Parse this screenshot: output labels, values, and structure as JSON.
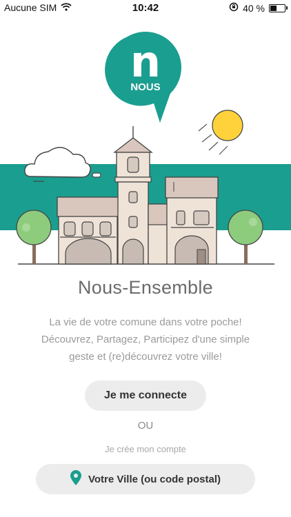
{
  "status_bar": {
    "carrier": "Aucune SIM",
    "time": "10:42",
    "battery_percent": "40 %",
    "battery_level": 0.4
  },
  "logo": {
    "letter": "n",
    "word": "NOUS"
  },
  "app": {
    "name": "Nous-Ensemble",
    "tagline_lines": [
      "La vie de votre comune dans votre poche!",
      "Découvrez, Partagez, Participez d'une simple",
      "geste et (re)découvrez votre ville!"
    ]
  },
  "actions": {
    "connect_label": "Je me connecte",
    "or_label": "OU",
    "create_account_label": "Je crée mon compte",
    "city_button_label": "Votre Ville (ou code postal)"
  },
  "colors": {
    "brand_teal": "#1a9e8f",
    "sun_yellow": "#ffd23c",
    "tree_green": "#8dcc7d",
    "building": "#efe3d8",
    "roof": "#d9c6bd"
  },
  "icons": [
    "wifi-icon",
    "rotation-lock-icon",
    "battery-icon",
    "location-pin-icon"
  ]
}
